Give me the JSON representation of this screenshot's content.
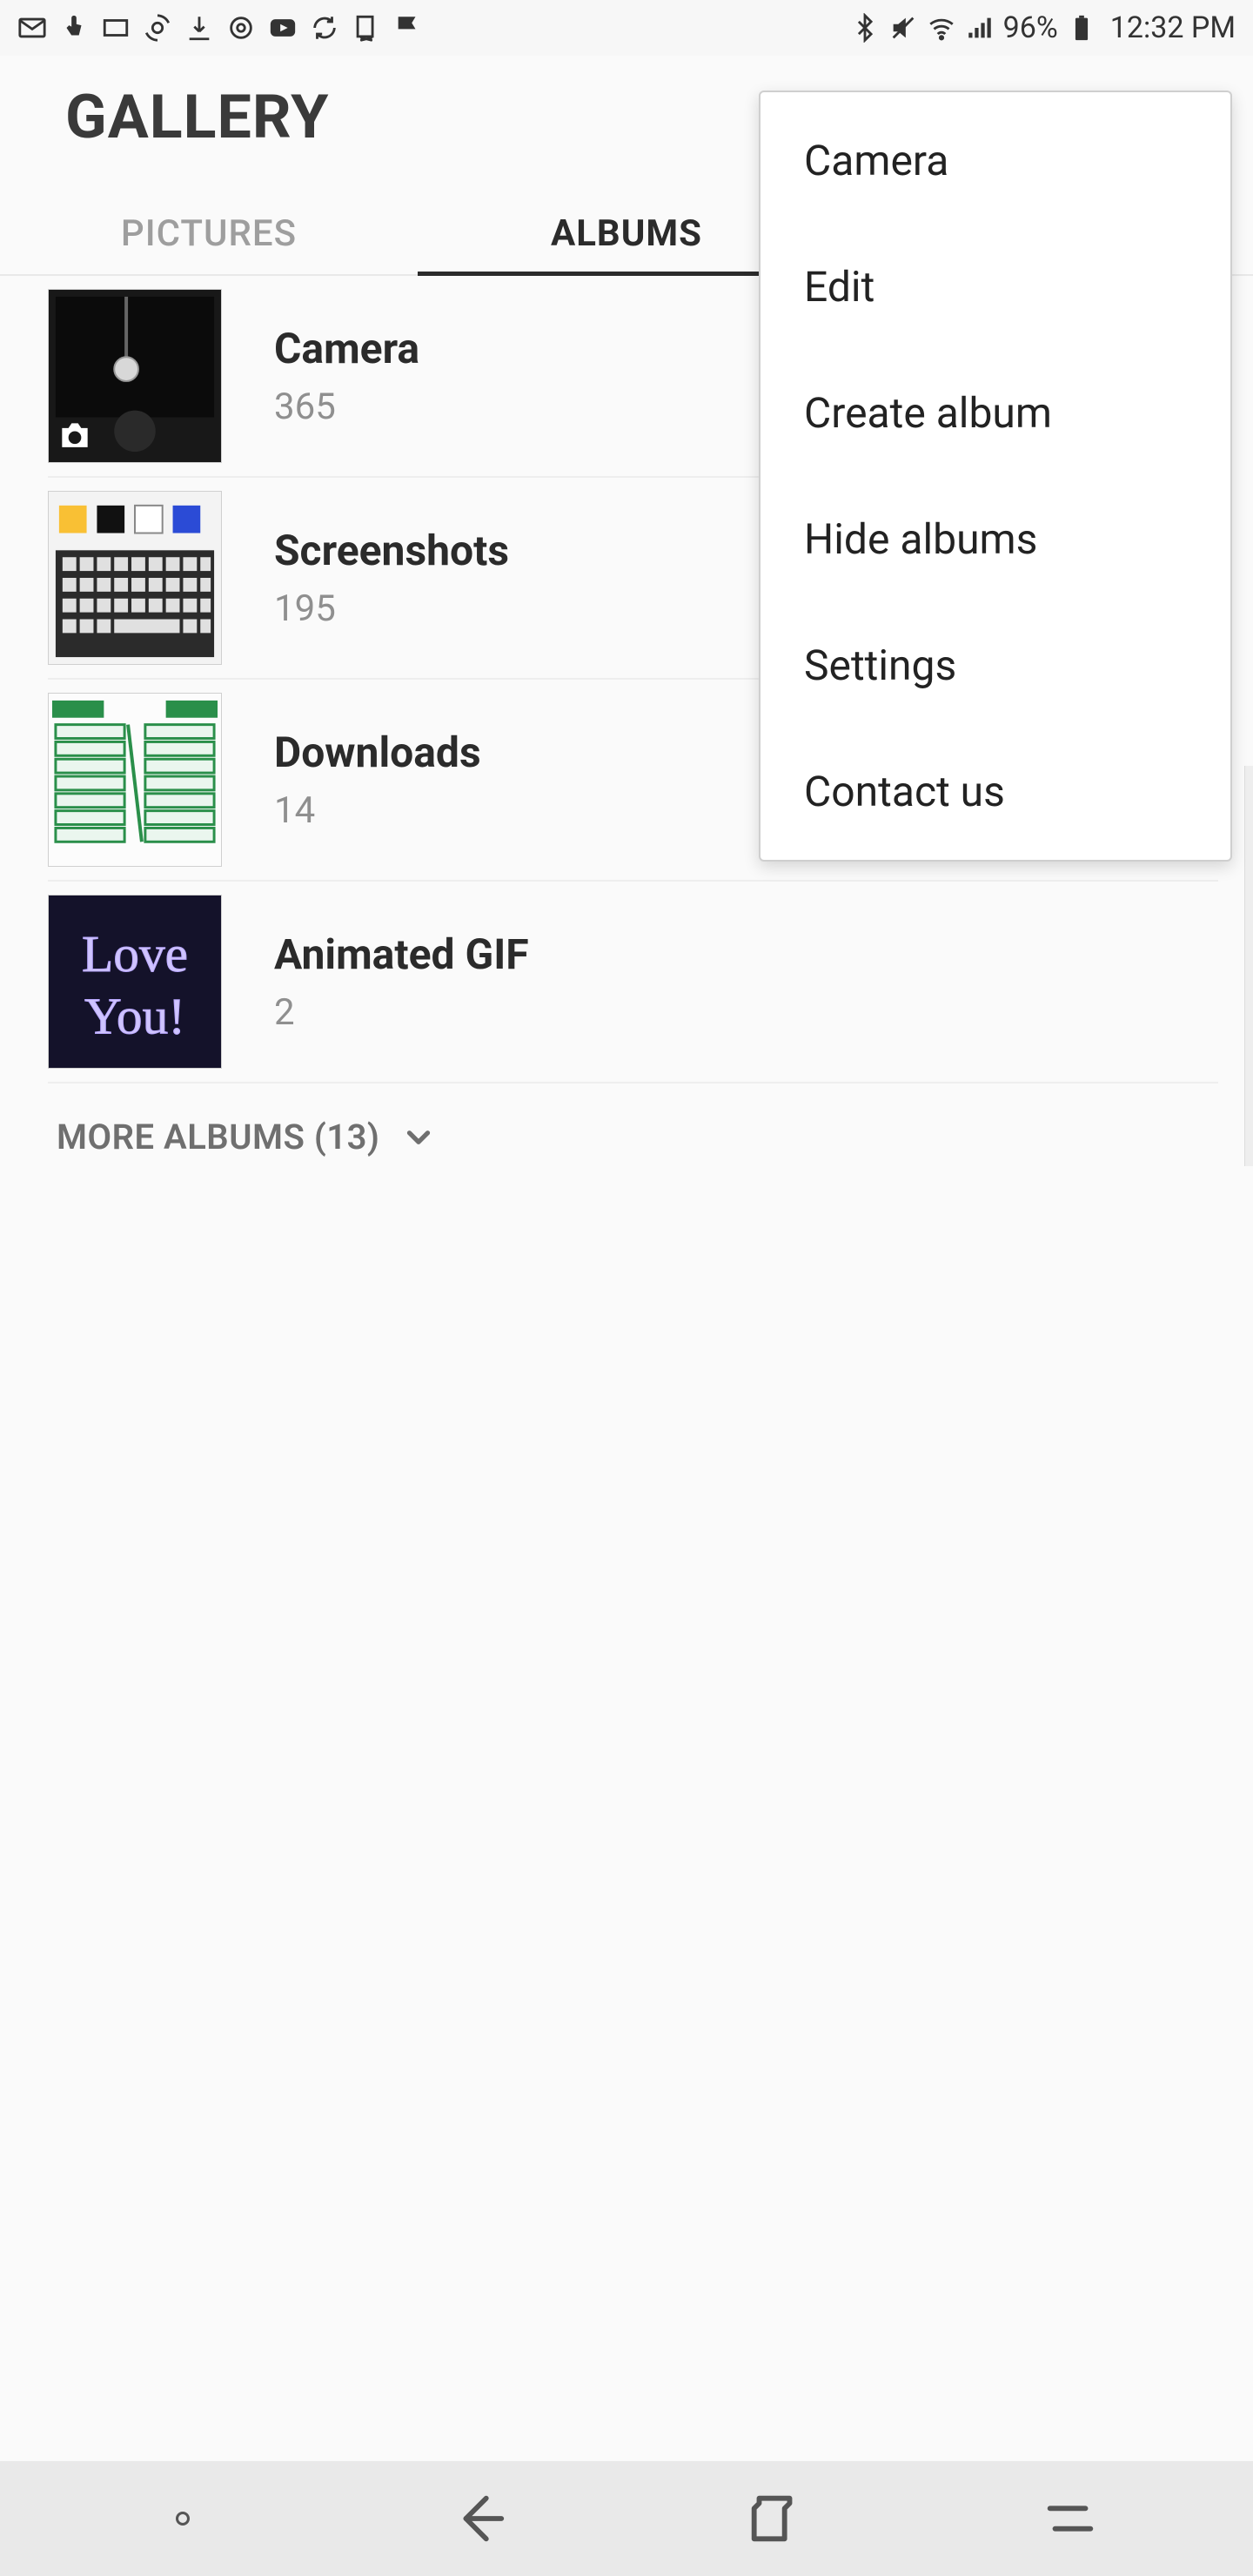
{
  "status": {
    "battery_pct": "96%",
    "time": "12:32 PM"
  },
  "header": {
    "title": "GALLERY"
  },
  "tabs": {
    "pictures": "PICTURES",
    "albums": "ALBUMS",
    "active": "albums"
  },
  "albums": [
    {
      "name": "Camera",
      "count": "365",
      "thumb": "camera-thumb",
      "badge": "camera"
    },
    {
      "name": "Screenshots",
      "count": "195",
      "thumb": "keyboard-thumb"
    },
    {
      "name": "Downloads",
      "count": "14",
      "thumb": "spreadsheet-thumb"
    },
    {
      "name": "Animated GIF",
      "count": "2",
      "thumb": "loveyou-thumb"
    }
  ],
  "more_albums": {
    "label": "MORE ALBUMS (13)"
  },
  "menu": {
    "items": [
      "Camera",
      "Edit",
      "Create album",
      "Hide albums",
      "Settings",
      "Contact us"
    ]
  },
  "colors": {
    "accent": "#2b2b2b",
    "muted": "#8f8f8f",
    "divider": "#eeeeee"
  }
}
